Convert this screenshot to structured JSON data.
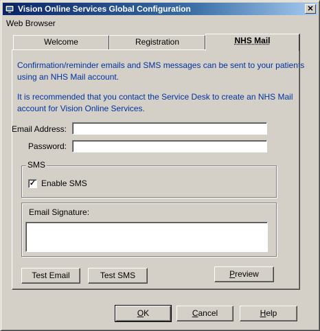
{
  "window": {
    "title": "Vision Online Services Global Configuration",
    "close_glyph": "✕"
  },
  "menu": {
    "label": "Web Browser"
  },
  "tabs": [
    {
      "label": "Welcome"
    },
    {
      "label": "Registration"
    },
    {
      "label": "NHS Mail"
    }
  ],
  "active_tab": "NHS Mail",
  "info": {
    "line1": "Confirmation/reminder emails and SMS messages can be sent to your patients",
    "line2": "using an NHS Mail account.",
    "line3": "It is recommended that you contact the Service Desk to create an NHS Mail",
    "line4": "account for Vision Online Services."
  },
  "form": {
    "email_label": "Email Address:",
    "email_value": "",
    "password_label": "Password:",
    "password_value": ""
  },
  "sms": {
    "group_label": "SMS",
    "enable_label": "Enable SMS",
    "enabled": true,
    "check_glyph": "✓"
  },
  "signature": {
    "group_label": "Email Signature:",
    "value": ""
  },
  "buttons": {
    "test_email": "Test Email",
    "test_sms": "Test SMS",
    "preview_rest": "review",
    "preview_mnemonic": "P",
    "ok_rest": "K",
    "ok_mnemonic": "O",
    "cancel_rest": "ancel",
    "cancel_mnemonic": "C",
    "help_rest": "elp",
    "help_mnemonic": "H"
  },
  "colors": {
    "info_text": "#0033a0",
    "titlebar_start": "#0a246a",
    "face": "#d4d0c8"
  }
}
